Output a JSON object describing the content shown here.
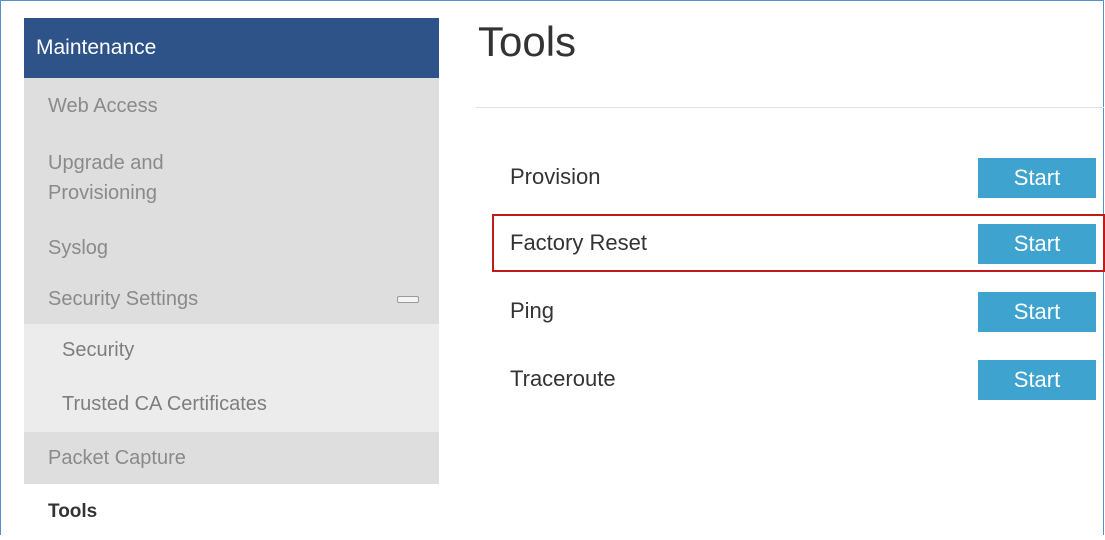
{
  "sidebar": {
    "header": "Maintenance",
    "items": {
      "web_access": "Web Access",
      "upgrade_line1": "Upgrade and",
      "upgrade_line2": "Provisioning",
      "syslog": "Syslog",
      "security_settings": "Security Settings",
      "security": "Security",
      "trusted_ca": "Trusted CA Certificates",
      "packet_capture": "Packet Capture",
      "tools": "Tools"
    },
    "collapse_icon": "minus-collapse-icon"
  },
  "main": {
    "title": "Tools",
    "tools": [
      {
        "label": "Provision",
        "button": "Start"
      },
      {
        "label": "Factory Reset",
        "button": "Start"
      },
      {
        "label": "Ping",
        "button": "Start"
      },
      {
        "label": "Traceroute",
        "button": "Start"
      }
    ],
    "highlighted_row": "Factory Reset"
  },
  "colors": {
    "sidebar_header": "#2d5389",
    "sidebar_item": "#dedede",
    "start_button": "#3ea3ce",
    "highlight": "#c11a1a"
  }
}
